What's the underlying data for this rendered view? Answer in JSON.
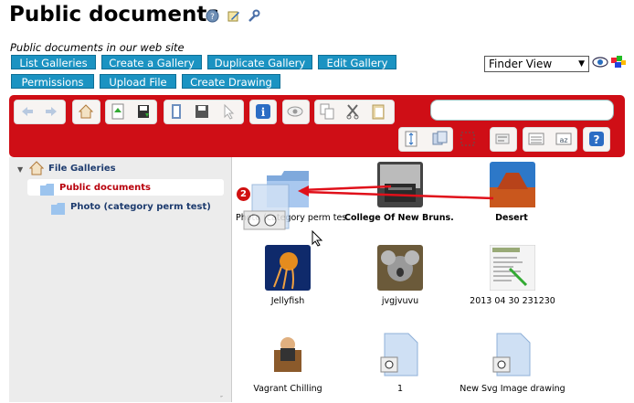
{
  "header": {
    "title": "Public documents",
    "description": "Public documents in our web site"
  },
  "actions": [
    "List Galleries",
    "Create a Gallery",
    "Duplicate Gallery",
    "Edit Gallery",
    "Permissions",
    "Upload File",
    "Create Drawing"
  ],
  "view": {
    "selected": "Finder View"
  },
  "tree": {
    "root": "File Galleries",
    "children": [
      "Public documents",
      "Photo (category perm test)"
    ]
  },
  "files": [
    {
      "name": "Photo (category perm test)",
      "kind": "folder"
    },
    {
      "name": "College Of New Bruns...",
      "kind": "image"
    },
    {
      "name": "Desert",
      "kind": "image"
    },
    {
      "name": "Jellyfish",
      "kind": "image"
    },
    {
      "name": "jvgjvuvu",
      "kind": "image"
    },
    {
      "name": "2013 04 30 231230",
      "kind": "image"
    },
    {
      "name": "Vagrant Chilling",
      "kind": "image"
    },
    {
      "name": "1",
      "kind": "file"
    },
    {
      "name": "New Svg Image drawing",
      "kind": "file"
    }
  ],
  "drag": {
    "count": "2"
  },
  "colors": {
    "toolbar": "#cf0e16",
    "button": "#1b93c2",
    "selected_tree_text": "#b8000c"
  }
}
